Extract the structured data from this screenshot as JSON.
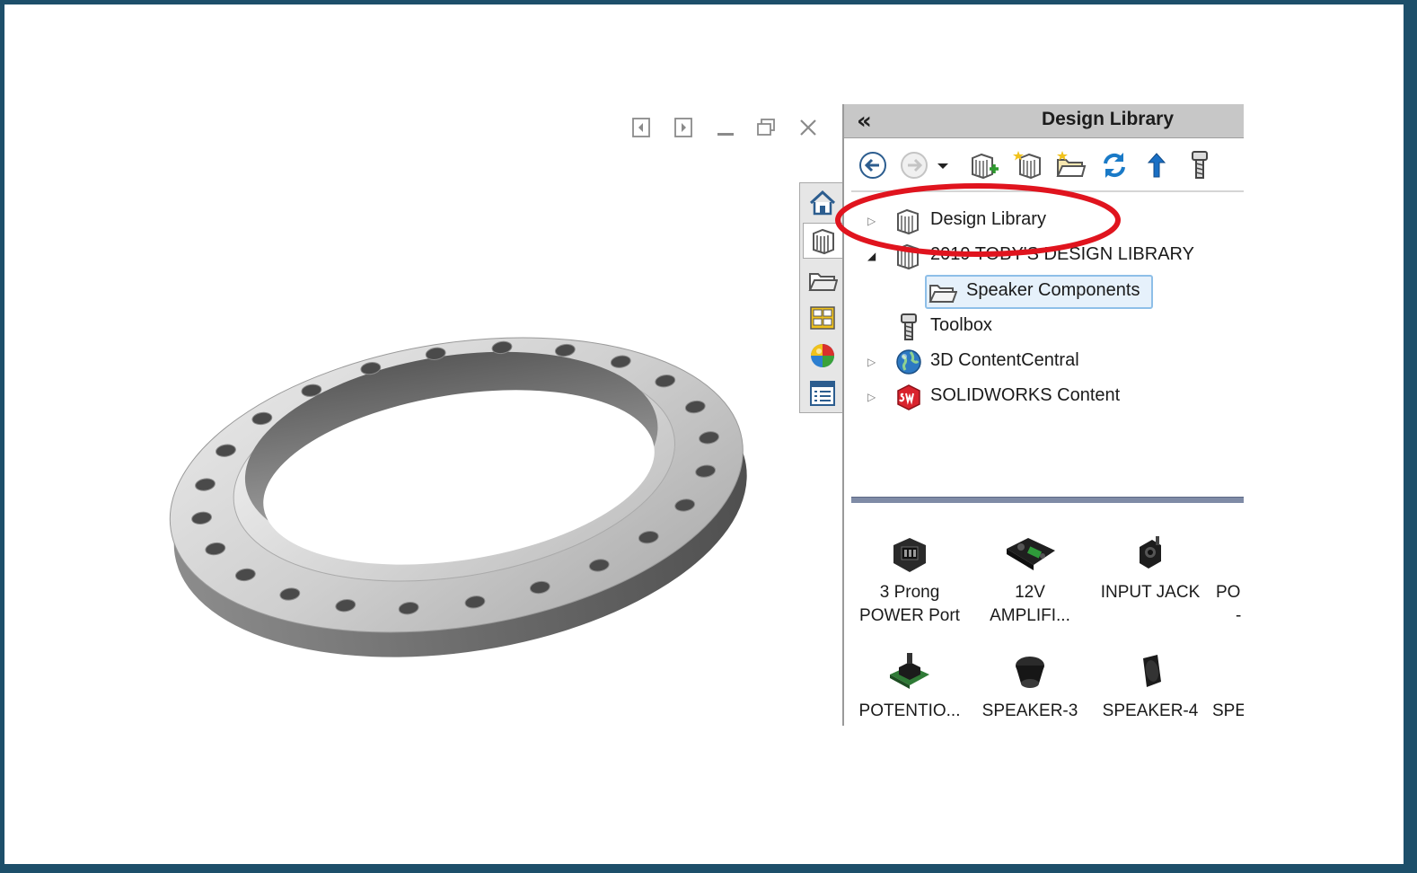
{
  "window_controls": [
    "dock-left-icon",
    "dock-right-icon",
    "minimize-icon",
    "restore-icon",
    "close-icon"
  ],
  "task_tabs": [
    "home-icon",
    "design-library-icon",
    "file-explorer-icon",
    "view-palette-icon",
    "appearances-icon",
    "custom-properties-icon"
  ],
  "pane": {
    "collapse_glyph": "«",
    "title": "Design Library"
  },
  "toolbar": [
    "back-icon",
    "forward-icon",
    "dropdown-icon",
    "add-to-library-icon",
    "add-file-location-icon",
    "create-new-folder-icon",
    "refresh-icon",
    "up-one-level-icon",
    "toolbox-icon"
  ],
  "tree": {
    "items": [
      {
        "label": "Design Library",
        "icon": "design-library-icon",
        "expander": "collapsed"
      },
      {
        "label": "2019 TOBY'S DESIGN LIBRARY",
        "icon": "design-library-icon",
        "expander": "expanded"
      },
      {
        "label": "Speaker Components",
        "icon": "folder-icon",
        "selected": true
      },
      {
        "label": "Toolbox",
        "icon": "toolbox-icon"
      },
      {
        "label": "3D ContentCentral",
        "icon": "globe-icon",
        "expander": "collapsed"
      },
      {
        "label": "SOLIDWORKS Content",
        "icon": "solidworks-icon",
        "expander": "collapsed"
      }
    ]
  },
  "gallery": {
    "items": [
      {
        "label_lines": [
          "3 Prong",
          "POWER Port"
        ]
      },
      {
        "label_lines": [
          "12V",
          "AMPLIFI..."
        ]
      },
      {
        "label_lines": [
          "INPUT JACK",
          ""
        ]
      },
      {
        "label_lines": [
          "PO",
          "-"
        ]
      },
      {
        "label_lines": [
          "POTENTIO...",
          ""
        ]
      },
      {
        "label_lines": [
          "SPEAKER-3",
          ""
        ]
      },
      {
        "label_lines": [
          "SPEAKER-4",
          ""
        ]
      },
      {
        "label_lines": [
          "SPE",
          ""
        ]
      }
    ]
  },
  "colors": {
    "border": "#1d4f6a",
    "highlight": "#e0141e",
    "header": "#c7c7c7",
    "selection": "#e6f1fb"
  }
}
